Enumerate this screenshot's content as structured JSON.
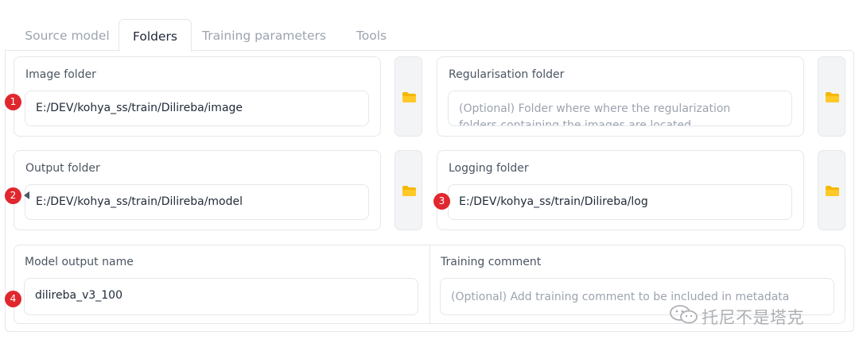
{
  "tabs": [
    {
      "label": "Source model"
    },
    {
      "label": "Folders",
      "active": true
    },
    {
      "label": "Training parameters"
    },
    {
      "label": "Tools"
    }
  ],
  "fields": {
    "image_folder": {
      "label": "Image folder",
      "value": "E:/DEV/kohya_ss/train/Dilireba/image"
    },
    "regularisation_folder": {
      "label": "Regularisation folder",
      "placeholder": "(Optional) Folder where where the regularization folders containing the images are located"
    },
    "output_folder": {
      "label": "Output folder",
      "value": "E:/DEV/kohya_ss/train/Dilireba/model"
    },
    "logging_folder": {
      "label": "Logging folder",
      "value": "E:/DEV/kohya_ss/train/Dilireba/log"
    },
    "model_output_name": {
      "label": "Model output name",
      "value": "dilireba_v3_100"
    },
    "training_comment": {
      "label": "Training comment",
      "placeholder": "(Optional) Add training comment to be included in metadata"
    }
  },
  "markers": [
    "1",
    "2",
    "3",
    "4"
  ],
  "icons": {
    "folder_button": "folder-icon",
    "folder_color": "#f5b800"
  },
  "accent": {
    "marker": "#e0272e"
  },
  "watermark": "托尼不是塔克"
}
